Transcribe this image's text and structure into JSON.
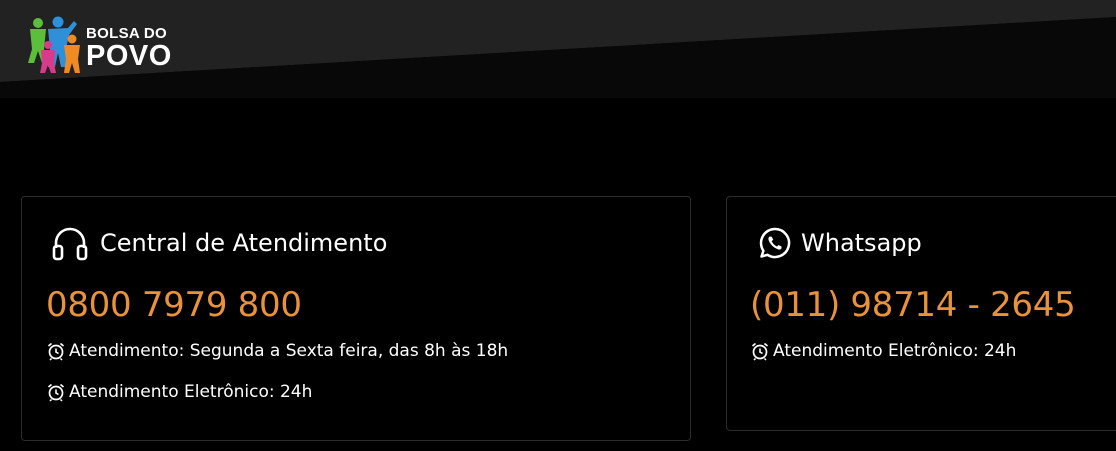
{
  "brand": {
    "logo_line1": "BOLSA DO",
    "logo_line2": "POVO",
    "colors": {
      "header_band": "#1f1f1f",
      "page_background": "#000000",
      "phone_accent": "#e8923a",
      "card_border": "#2c2c2c"
    }
  },
  "cards": {
    "central": {
      "title": "Central de Atendimento",
      "icon": "headphones-icon",
      "phone": "0800 7979 800",
      "lines": [
        "Atendimento: Segunda a Sexta feira, das 8h às 18h",
        "Atendimento Eletrônico: 24h"
      ]
    },
    "whatsapp": {
      "title": "Whatsapp",
      "icon": "whatsapp-icon",
      "phone": "(011) 98714 - 2645",
      "lines": [
        "Atendimento Eletrônico: 24h"
      ]
    }
  }
}
